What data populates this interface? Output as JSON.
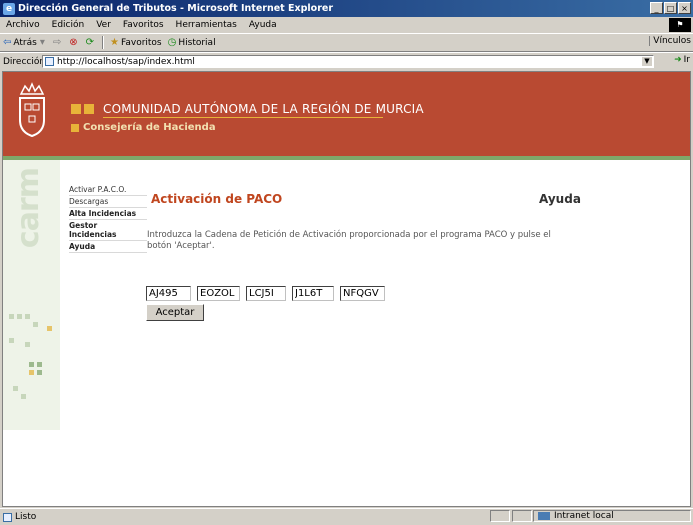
{
  "window": {
    "title": "Dirección General de Tributos - Microsoft Internet Explorer",
    "controls": {
      "minimize": "_",
      "maximize": "□",
      "close": "×"
    }
  },
  "menu": {
    "items": [
      "Archivo",
      "Edición",
      "Ver",
      "Favoritos",
      "Herramientas",
      "Ayuda"
    ]
  },
  "toolbar": {
    "back": "Atrás",
    "favorites": "Favoritos",
    "history": "Historial",
    "links": "Vínculos"
  },
  "address": {
    "label": "Dirección",
    "url": "http://localhost/sap/index.html",
    "go": "Ir"
  },
  "header": {
    "org_title": "COMUNIDAD AUTÓNOMA DE LA REGIÓN DE MURCIA",
    "org_sub": "Consejería de Hacienda",
    "brand_vertical": "carm"
  },
  "nav": {
    "items": [
      "Activar P.A.C.O.",
      "Descargas",
      "Alta Incidencias",
      "Gestor Incidencias",
      "Ayuda"
    ]
  },
  "content": {
    "title": "Activación de PACO",
    "help": "Ayuda",
    "instructions": "Introduzca la Cadena de Petición de Activación proporcionada por el programa PACO y pulse el botón 'Aceptar'.",
    "fields": [
      "AJ495",
      "EOZOL",
      "LCJ5I",
      "J1L6T",
      "NFQGV"
    ],
    "accept": "Aceptar"
  },
  "status": {
    "text": "Listo",
    "zone": "Intranet local"
  }
}
